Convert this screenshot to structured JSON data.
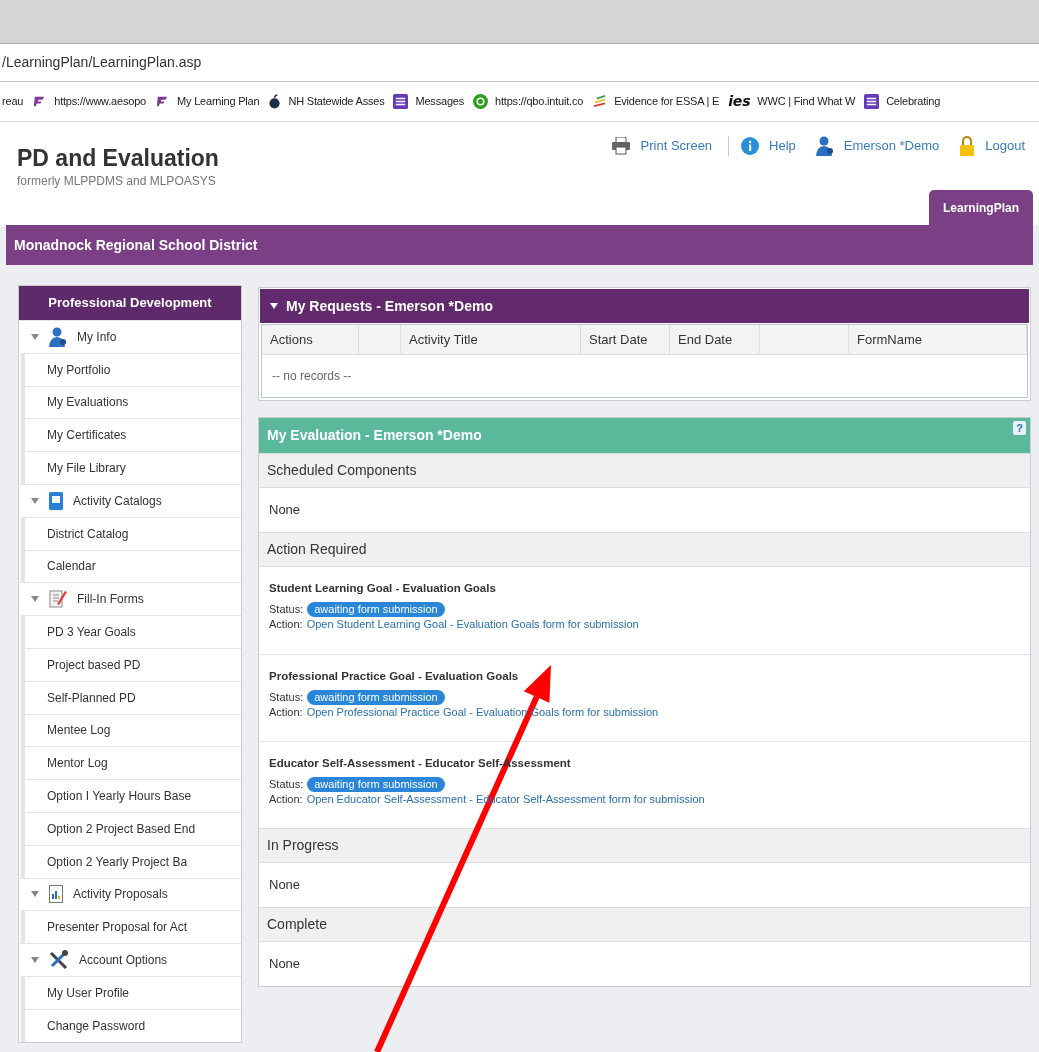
{
  "browser": {
    "url": "/LearningPlan/LearningPlan.asp",
    "bookmarks": [
      {
        "kind": "plain",
        "label": "reau"
      },
      {
        "kind": "brand",
        "label": "https://www.aesopo"
      },
      {
        "kind": "brand",
        "label": "My Learning Plan"
      },
      {
        "kind": "apple",
        "label": "NH Statewide Asses"
      },
      {
        "kind": "list",
        "label": "Messages"
      },
      {
        "kind": "qb",
        "label": "https://qbo.intuit.co"
      },
      {
        "kind": "stripes",
        "label": "Evidence for ESSA | E"
      },
      {
        "kind": "text",
        "icon_text": "ies",
        "label": "WWC | Find What W"
      },
      {
        "kind": "list",
        "label": "Celebrating"
      }
    ]
  },
  "header": {
    "title": "PD and Evaluation",
    "subtitle": "formerly MLPPDMS and MLPOASYS",
    "links": [
      {
        "kind": "print",
        "label": "Print Screen"
      },
      {
        "kind": "help",
        "label": "Help"
      },
      {
        "kind": "user",
        "label": "Emerson *Demo"
      },
      {
        "kind": "lock",
        "label": "Logout"
      }
    ],
    "tabs": [
      {
        "label": "LearningPlan",
        "selected": true
      }
    ]
  },
  "district": "Monadnock Regional School District",
  "sidebar": {
    "title": "Professional Development",
    "groups": [
      {
        "kind": "user",
        "label": "My Info",
        "expanded": true,
        "children": [
          {
            "label": "My Portfolio"
          },
          {
            "label": "My Evaluations"
          },
          {
            "label": "My Certificates"
          },
          {
            "label": "My File Library"
          }
        ]
      },
      {
        "kind": "catalog",
        "label": "Activity Catalogs",
        "expanded": true,
        "children": [
          {
            "label": "District Catalog"
          },
          {
            "label": "Calendar"
          }
        ]
      },
      {
        "kind": "form",
        "label": "Fill-In Forms",
        "expanded": true,
        "children": [
          {
            "label": "PD 3 Year Goals"
          },
          {
            "label": "Project based PD"
          },
          {
            "label": "Self-Planned PD"
          },
          {
            "label": "Mentee Log"
          },
          {
            "label": "Mentor Log"
          },
          {
            "label": "Option I Yearly Hours Base"
          },
          {
            "label": "Option 2 Project Based End"
          },
          {
            "label": "Option 2 Yearly Project Ba"
          }
        ]
      },
      {
        "kind": "proposal",
        "label": "Activity Proposals",
        "expanded": true,
        "children": [
          {
            "label": "Presenter Proposal for Act"
          }
        ]
      },
      {
        "kind": "tools",
        "label": "Account Options",
        "expanded": true,
        "children": [
          {
            "label": "My User Profile"
          },
          {
            "label": "Change Password"
          }
        ]
      }
    ]
  },
  "requests": {
    "title": "My Requests - Emerson *Demo",
    "expanded": true,
    "columns": [
      {
        "kind": "label",
        "label": "Actions"
      },
      {
        "kind": "blank"
      },
      {
        "kind": "label",
        "label": "Activity Title"
      },
      {
        "kind": "label",
        "label": "Start Date"
      },
      {
        "kind": "label",
        "label": "End Date"
      },
      {
        "kind": "blank"
      },
      {
        "kind": "label",
        "label": "FormName"
      }
    ],
    "empty_text": "-- no records --"
  },
  "evaluation": {
    "title": "My Evaluation - Emerson *Demo",
    "help_badge": "?",
    "sections": [
      {
        "heading": "Scheduled Components",
        "empty_text": "None"
      },
      {
        "heading": "Action Required",
        "items": [
          {
            "title": "Student Learning Goal - Evaluation Goals",
            "status_label": "Status:",
            "status": "awaiting form submission",
            "action_label": "Action:",
            "action": "Open Student Learning Goal - Evaluation Goals form for submission"
          },
          {
            "title": "Professional Practice Goal - Evaluation Goals",
            "status_label": "Status:",
            "status": "awaiting form submission",
            "action_label": "Action:",
            "action": "Open Professional Practice Goal - Evaluation Goals form for submission"
          },
          {
            "title": "Educator Self-Assessment - Educator Self-Assessment",
            "status_label": "Status:",
            "status": "awaiting form submission",
            "action_label": "Action:",
            "action": "Open Educator Self-Assessment - Educator Self-Assessment form for submission"
          }
        ]
      },
      {
        "heading": "In Progress",
        "empty_text": "None"
      },
      {
        "heading": "Complete",
        "empty_text": "None"
      }
    ]
  },
  "annotation": {
    "kind": "arrow"
  }
}
